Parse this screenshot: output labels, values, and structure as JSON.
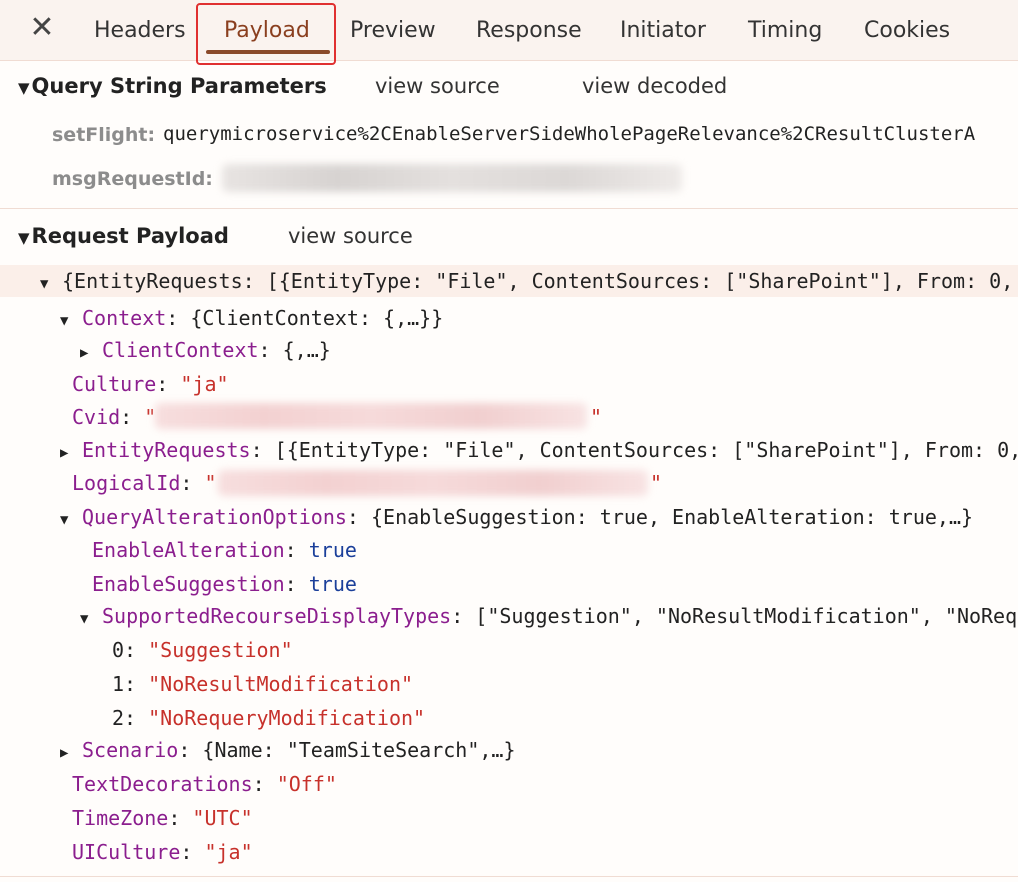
{
  "tabs": {
    "close": "✕",
    "items": [
      "Headers",
      "Payload",
      "Preview",
      "Response",
      "Initiator",
      "Timing",
      "Cookies"
    ],
    "active": "Payload"
  },
  "query": {
    "title": "Query String Parameters",
    "view_source": "view source",
    "view_decoded": "view decoded",
    "params": [
      {
        "key": "setFlight:",
        "value": "querymicroservice%2CEnableServerSideWholePageRelevance%2CResultClusterA"
      },
      {
        "key": "msgRequestId:",
        "value": ""
      }
    ]
  },
  "payload": {
    "title": "Request Payload",
    "view_source": "view source",
    "root": "{EntityRequests: [{EntityType: \"File\", ContentSources: [\"SharePoint\"], From: 0,",
    "context_key": "Context",
    "context_val": "{ClientContext: {,…}}",
    "clientcontext_key": "ClientContext",
    "clientcontext_val": "{,…}",
    "culture_key": "Culture",
    "culture_val": "\"ja\"",
    "cvid_key": "Cvid",
    "entityrequests_key": "EntityRequests",
    "entityrequests_val": "[{EntityType: \"File\", ContentSources: [\"SharePoint\"], From: 0,",
    "logicalid_key": "LogicalId",
    "qao_key": "QueryAlterationOptions",
    "qao_val": "{EnableSuggestion: true, EnableAlteration: true,…}",
    "enablealteration_key": "EnableAlteration",
    "enablealteration_val": "true",
    "enablesuggestion_key": "EnableSuggestion",
    "enablesuggestion_val": "true",
    "srdt_key": "SupportedRecourseDisplayTypes",
    "srdt_val": "[\"Suggestion\", \"NoResultModification\", \"NoRequ",
    "items": [
      {
        "idx": "0",
        "val": "\"Suggestion\""
      },
      {
        "idx": "1",
        "val": "\"NoResultModification\""
      },
      {
        "idx": "2",
        "val": "\"NoRequeryModification\""
      }
    ],
    "scenario_key": "Scenario",
    "scenario_val": "{Name: \"TeamSiteSearch\",…}",
    "textdecorations_key": "TextDecorations",
    "textdecorations_val": "\"Off\"",
    "timezone_key": "TimeZone",
    "timezone_val": "\"UTC\"",
    "uiculture_key": "UICulture",
    "uiculture_val": "\"ja\""
  },
  "colors": {
    "key": "#8b1e8e",
    "string": "#c7312b",
    "boolean": "#1b3f9a",
    "active_tab": "#8a3f1f",
    "highlight_box": "#e03030"
  }
}
